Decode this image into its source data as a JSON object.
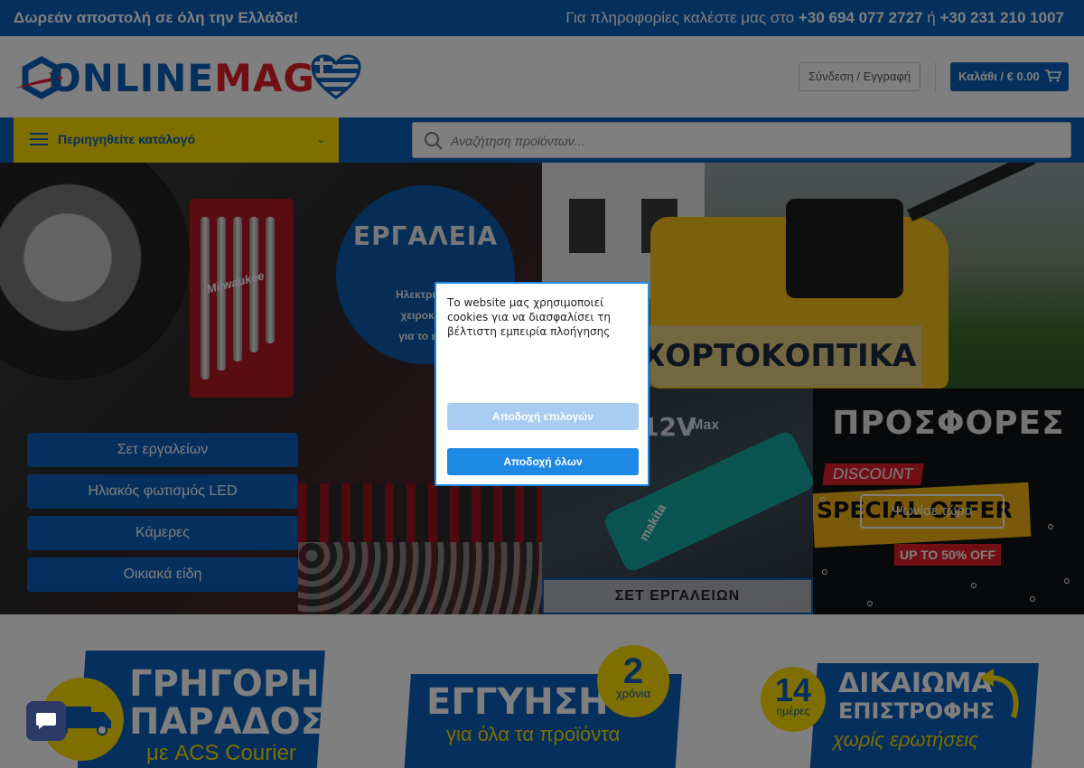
{
  "topbar": {
    "free_shipping": "Δωρεάν αποστολή σε όλη την Ελλάδα!",
    "info_prefix": "Για πληροφορίες καλέστε μας στο",
    "phone1": "+30 694 077 2727",
    "or": "ή",
    "phone2": "+30 231 210 1007"
  },
  "header": {
    "logo_part1": "ONLINE",
    "logo_part2": "MAG",
    "login_label": "Σύνδεση / Εγγραφή",
    "cart_label": "Καλάθι / € 0.00",
    "cart_icon": "cart-icon"
  },
  "nav": {
    "catalog_label": "Περιηγηθείτε κατάλογό",
    "search_placeholder": "Αναζήτηση προϊόντων..."
  },
  "hero": {
    "tools": {
      "title": "ΕΡΓΑΛΕΙΑ",
      "subtitle_line1": "Ηλεκτρικά και",
      "subtitle_line2": "χειροκίνητα",
      "subtitle_line3": "για το εργασ",
      "brand_on_rack": "Milwaukee",
      "categories": [
        "Σετ εργαλείων",
        "Ηλιακός φωτισμός LED",
        "Κάμερες",
        "Οικιακά είδη"
      ]
    },
    "mower": {
      "title": "ΧΟΡΤΟΚΟΠΤΙΚΑ"
    },
    "drill": {
      "voltage": "12V",
      "max": "Max",
      "brand": "makita",
      "caption": "ΣΕΤ ΕΡΓΑΛΕΙΩΝ"
    },
    "offers": {
      "title": "ΠΡΟΣΦΟΡΕΣ",
      "discount": "DISCOUNT",
      "special": "SPECIAL OFFER",
      "upto": "UP TO 50% OFF",
      "shop_now": "Ψωνίσε τώρα"
    }
  },
  "features": [
    {
      "title_line1": "ΓΡΗΓΟΡΗ",
      "title_line2": "ΠΑΡΑΔΟΣΗ",
      "sub": "με ACS Courier"
    },
    {
      "title_line1": "ΕΓΓΥΗΣΗ",
      "sub": "για όλα τα προϊόντα",
      "badge_num": "2",
      "badge_text": "χρόνια"
    },
    {
      "title_line1": "ΔΙΚΑΙΩΜΑ",
      "title_line2": "ΕΠΙΣΤΡΟΦΗΣ",
      "sub": "χωρίς ερωτήσεις",
      "badge_num": "14",
      "badge_text": "ημέρες"
    }
  ],
  "cookie_modal": {
    "text": "Το website μας χρησιμοποιεί cookies για να διασφαλίσει τη βέλτιστη εμπειρία πλοήγησης",
    "accept_selected": "Αποδοχή επιλογών",
    "accept_all": "Αποδοχή όλων"
  },
  "colors": {
    "brand_blue": "#0a5fb8",
    "brand_red": "#e32028",
    "brand_yellow": "#fedc00",
    "modal_blue": "#1e88e5"
  }
}
